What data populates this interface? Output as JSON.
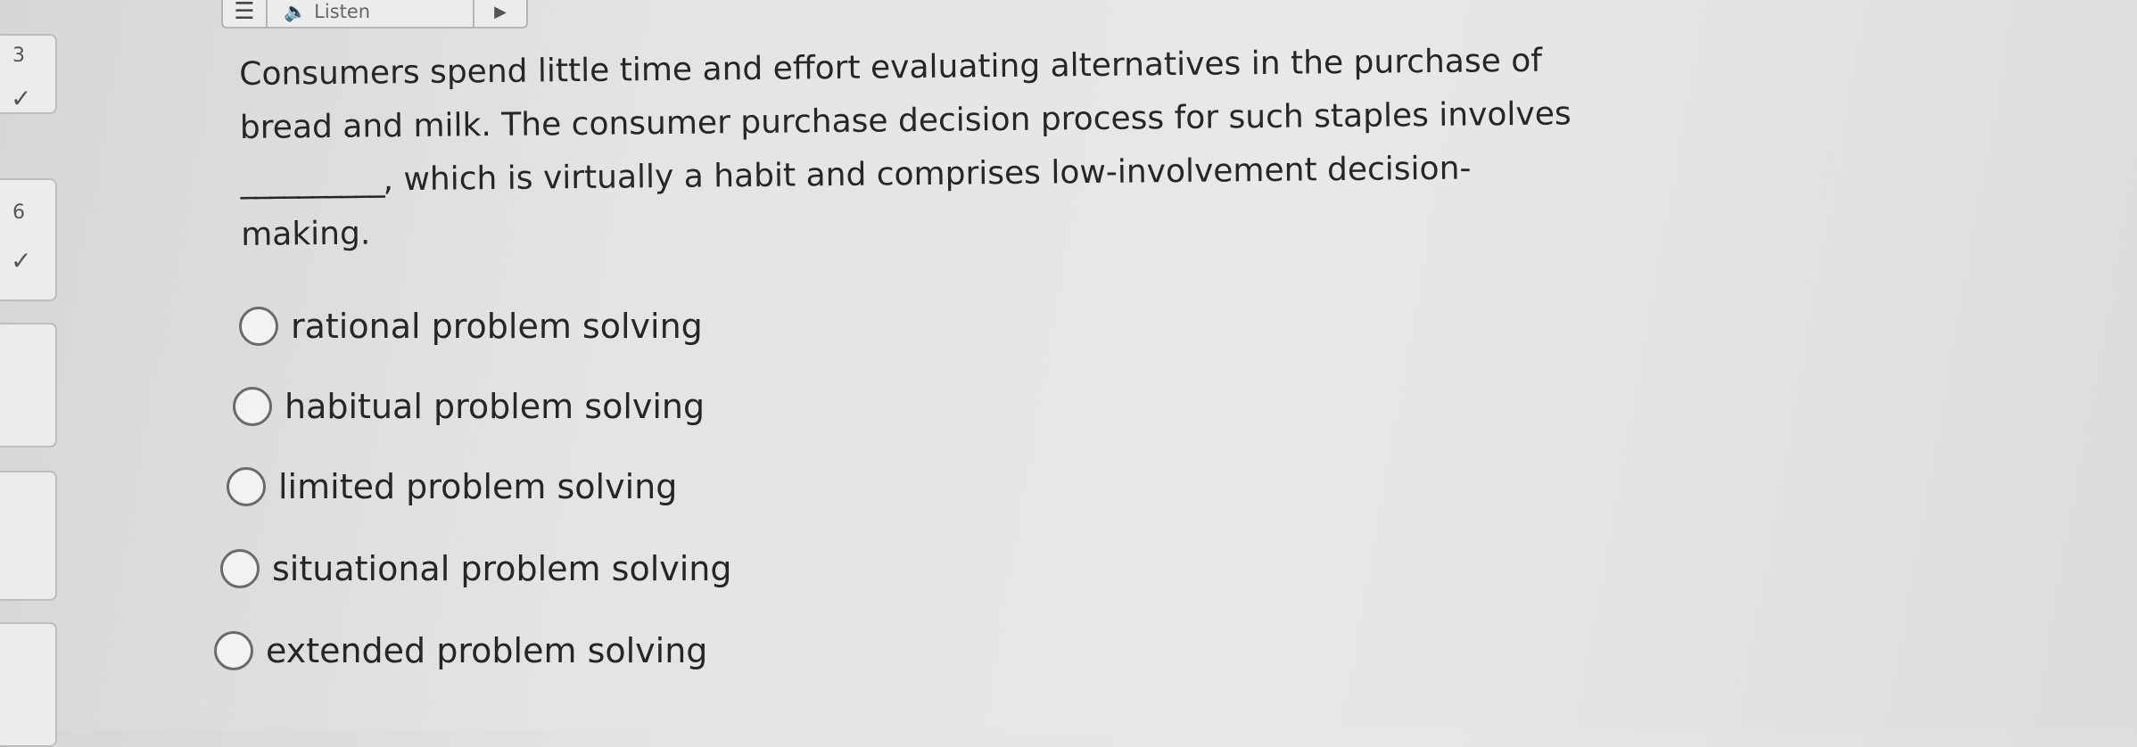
{
  "toolbar": {
    "menu_icon": "hamburger-icon",
    "listen_icon": "speaker-icon",
    "listen_label": "Listen",
    "play_icon": "play-icon"
  },
  "navigator": {
    "items": [
      {
        "number": "3",
        "status_icon": "checkmark-icon"
      },
      {
        "number": "6",
        "status_icon": "checkmark-icon"
      },
      {
        "number": "",
        "status_icon": ""
      },
      {
        "number": "",
        "status_icon": ""
      },
      {
        "number": "",
        "status_icon": ""
      }
    ]
  },
  "question": {
    "line1": "Consumers spend little time and effort evaluating alternatives in the purchase of",
    "line2": "bread and milk. The consumer purchase decision process for such staples involves",
    "blank": "__________",
    "line3_rest": ", which is virtually a habit and comprises low-involvement decision-",
    "line4": "making."
  },
  "options": [
    {
      "label": "rational problem solving"
    },
    {
      "label": "habitual problem solving"
    },
    {
      "label": "limited problem solving"
    },
    {
      "label": "situational problem solving"
    },
    {
      "label": "extended problem solving"
    }
  ]
}
